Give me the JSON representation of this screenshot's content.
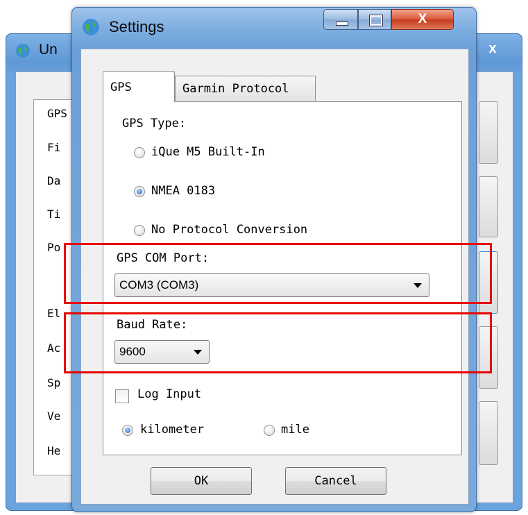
{
  "background_window": {
    "title_partial": "Un",
    "close_glyph": "x",
    "tab_partial": "GPS",
    "labels": [
      "Fi",
      "Da",
      "Ti",
      "Po",
      "El",
      "Ac",
      "Sp",
      "Ve",
      "He"
    ]
  },
  "settings": {
    "title": "Settings",
    "title_buttons": {
      "close": "X"
    },
    "tabs": [
      "GPS",
      "Garmin Protocol"
    ],
    "gps_type": {
      "label": "GPS Type:",
      "options": [
        "iQue M5 Built-In",
        "NMEA 0183",
        "No Protocol Conversion"
      ],
      "selected": "NMEA 0183"
    },
    "com_port": {
      "label": "GPS COM Port:",
      "value": "COM3 (COM3)"
    },
    "baud_rate": {
      "label": "Baud Rate:",
      "value": "9600"
    },
    "log_input": {
      "label": "Log Input",
      "checked": false
    },
    "units": {
      "options": [
        "kilometer",
        "mile"
      ],
      "selected": "kilometer"
    },
    "buttons": {
      "ok": "OK",
      "cancel": "Cancel"
    }
  },
  "colors": {
    "highlight": "#e80000",
    "title_bar": "#7eaee0",
    "close_button": "#c43a1c"
  },
  "icons": [
    "globe-icon",
    "minimize-icon",
    "maximize-icon",
    "close-icon",
    "dropdown-arrow-icon"
  ]
}
